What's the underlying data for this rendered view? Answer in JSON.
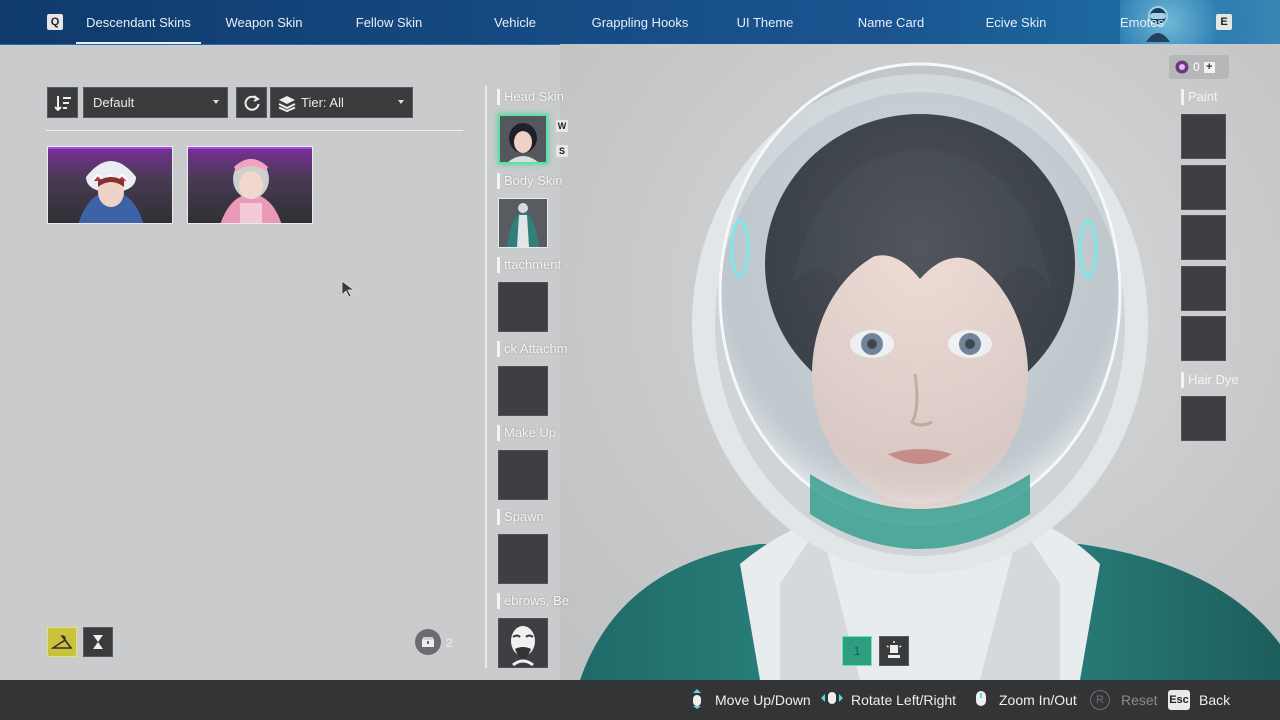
{
  "nav": {
    "left_key": "Q",
    "right_key": "E",
    "tabs": [
      {
        "label": "Descendant Skins",
        "active": true
      },
      {
        "label": "Weapon Skin",
        "active": false
      },
      {
        "label": "Fellow Skin",
        "active": false
      },
      {
        "label": "Vehicle",
        "active": false
      },
      {
        "label": "Grappling Hooks",
        "active": false
      },
      {
        "label": "UI Theme",
        "active": false
      },
      {
        "label": "Name Card",
        "active": false
      },
      {
        "label": "Ecive Skin",
        "active": false
      },
      {
        "label": "Emotes",
        "active": false
      }
    ]
  },
  "filters": {
    "sort_value": "Default",
    "tier_value": "Tier: All"
  },
  "skins": [
    "shark-hood-skin",
    "pink-nurse-skin"
  ],
  "slots": [
    {
      "label": "Head Skin",
      "equipped": true,
      "tags": [
        "W",
        "S"
      ]
    },
    {
      "label": "Body Skin",
      "equipped": true
    },
    {
      "label": "Attachment",
      "display": "ttachment"
    },
    {
      "label": "Back Attachment",
      "display": "ck Attachm"
    },
    {
      "label": "Make Up"
    },
    {
      "label": "Spawn"
    },
    {
      "label": "Eyebrows, Beard",
      "display": "ebrows, Be"
    }
  ],
  "right_panel": {
    "currency_amount": "0",
    "paint_label": "Paint",
    "hair_dye_label": "Hair Dye"
  },
  "bottom_left": {
    "storage_count": "2"
  },
  "view_mode": {
    "selected_number": "1"
  },
  "hints": [
    {
      "label": "Move Up/Down",
      "enabled": true
    },
    {
      "label": "Rotate Left/Right",
      "enabled": true
    },
    {
      "label": "Zoom In/Out",
      "enabled": true
    },
    {
      "label": "Reset",
      "key": "R",
      "enabled": false
    },
    {
      "label": "Back",
      "key": "Esc",
      "enabled": true
    }
  ],
  "colors": {
    "accent_green": "#5ee0a6",
    "nav_blue": "#154a82",
    "skin_purple": "#a44de0",
    "wardrobe_yellow": "#c9c23a"
  }
}
